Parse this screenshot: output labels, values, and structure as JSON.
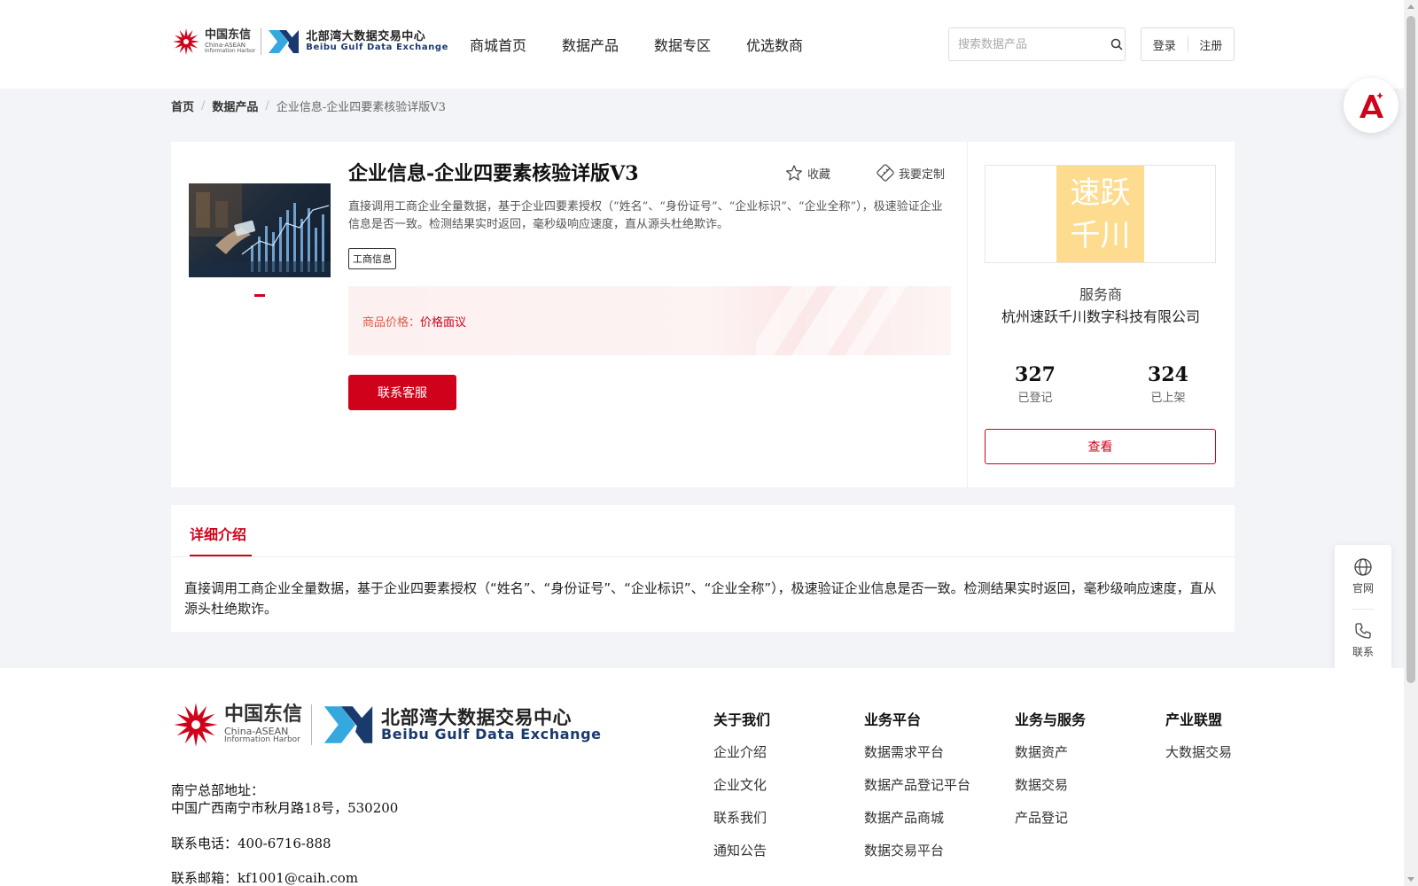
{
  "header": {
    "logo_cn": {
      "title": "中国东信",
      "line1": "China-ASEAN",
      "line2": "Information Harbor"
    },
    "logo_bg": {
      "title": "北部湾大数据交易中心",
      "subtitle": "Beibu Gulf Data Exchange"
    },
    "nav": [
      {
        "label": "商城首页"
      },
      {
        "label": "数据产品"
      },
      {
        "label": "数据专区"
      },
      {
        "label": "优选数商"
      }
    ],
    "search": {
      "placeholder": "搜索数据产品",
      "value": ""
    },
    "login_label": "登录",
    "register_label": "注册"
  },
  "breadcrumb": {
    "home": "首页",
    "category": "数据产品",
    "current": "企业信息-企业四要素核验详版V3"
  },
  "product": {
    "title": "企业信息-企业四要素核验详版V3",
    "favorite_label": "收藏",
    "customize_label": "我要定制",
    "description": "直接调用工商企业全量数据，基于企业四要素授权（“姓名”、“身份证号”、“企业标识”、“企业全称”），极速验证企业信息是否一致。检测结果实时返回，毫秒级响应速度，直从源头杜绝欺诈。",
    "tag": "工商信息",
    "price_label": "商品价格：",
    "price_value": "价格面议",
    "contact_button": "联系客服"
  },
  "vendor": {
    "logo_line1": "速跃",
    "logo_line2": "千川",
    "role": "服务商",
    "name": "杭州速跃千川数字科技有限公司",
    "registered_count": "327",
    "registered_label": "已登记",
    "listed_count": "324",
    "listed_label": "已上架",
    "view_button": "查看"
  },
  "detail": {
    "tab_label": "详细介绍",
    "text": "直接调用工商企业全量数据，基于企业四要素授权（“姓名”、“身份证号”、“企业标识”、“企业全称”），极速验证企业信息是否一致。检测结果实时返回，毫秒级响应速度，直从源头杜绝欺诈。"
  },
  "float_sidebar": {
    "website_label": "官网",
    "contact_label": "联系"
  },
  "footer": {
    "address_label": "南宁总部地址：",
    "address": "中国广西南宁市秋月路18号，530200",
    "phone": "联系电话：400-6716-888",
    "email": "联系邮箱：kf1001@caih.com",
    "columns": [
      {
        "title": "关于我们",
        "links": [
          "企业介绍",
          "企业文化",
          "联系我们",
          "通知公告"
        ]
      },
      {
        "title": "业务平台",
        "links": [
          "数据需求平台",
          "数据产品登记平台",
          "数据产品商城",
          "数据交易平台"
        ]
      },
      {
        "title": "业务与服务",
        "links": [
          "数据资产",
          "数据交易",
          "产品登记"
        ]
      },
      {
        "title": "产业联盟",
        "links": [
          "大数据交易"
        ]
      }
    ]
  },
  "colors": {
    "accent": "#d0021b",
    "page_bg": "#f3f4f7",
    "vendor_logo_bg": "#fddc8f"
  },
  "icons": [
    "star-icon",
    "customize-icon",
    "search-icon",
    "globe-icon",
    "phone-icon",
    "ai-assistant-icon"
  ]
}
